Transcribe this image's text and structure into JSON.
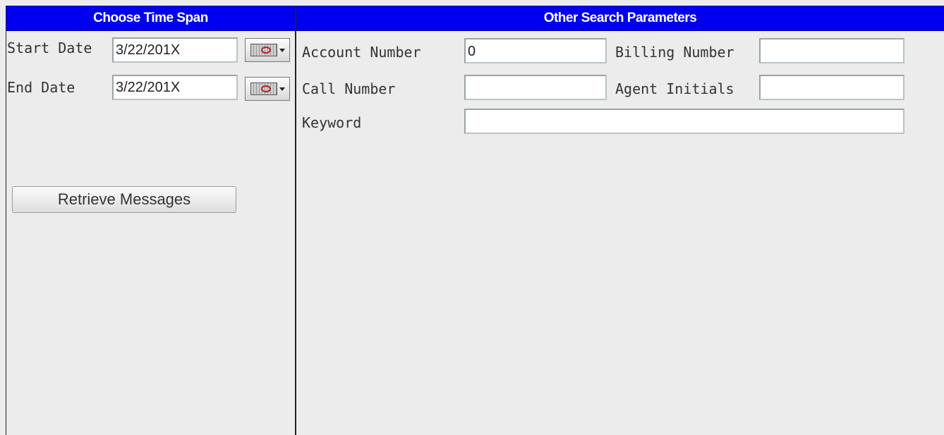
{
  "time_span": {
    "header": "Choose Time Span",
    "start_label": "Start Date",
    "start_value": "3/22/201X",
    "end_label": "End Date",
    "end_value": "3/22/201X",
    "calendar_icon": "calendar-icon",
    "retrieve_label": "Retrieve Messages"
  },
  "search": {
    "header": "Other Search Parameters",
    "account_label": "Account Number",
    "account_value": "0",
    "billing_label": "Billing Number",
    "billing_value": "",
    "call_label": "Call Number",
    "call_value": "",
    "agent_label": "Agent Initials",
    "agent_value": "",
    "keyword_label": "Keyword",
    "keyword_value": ""
  },
  "colors": {
    "header_bg": "#0000ee",
    "header_text": "#ffffff",
    "panel_bg": "#ececec"
  }
}
